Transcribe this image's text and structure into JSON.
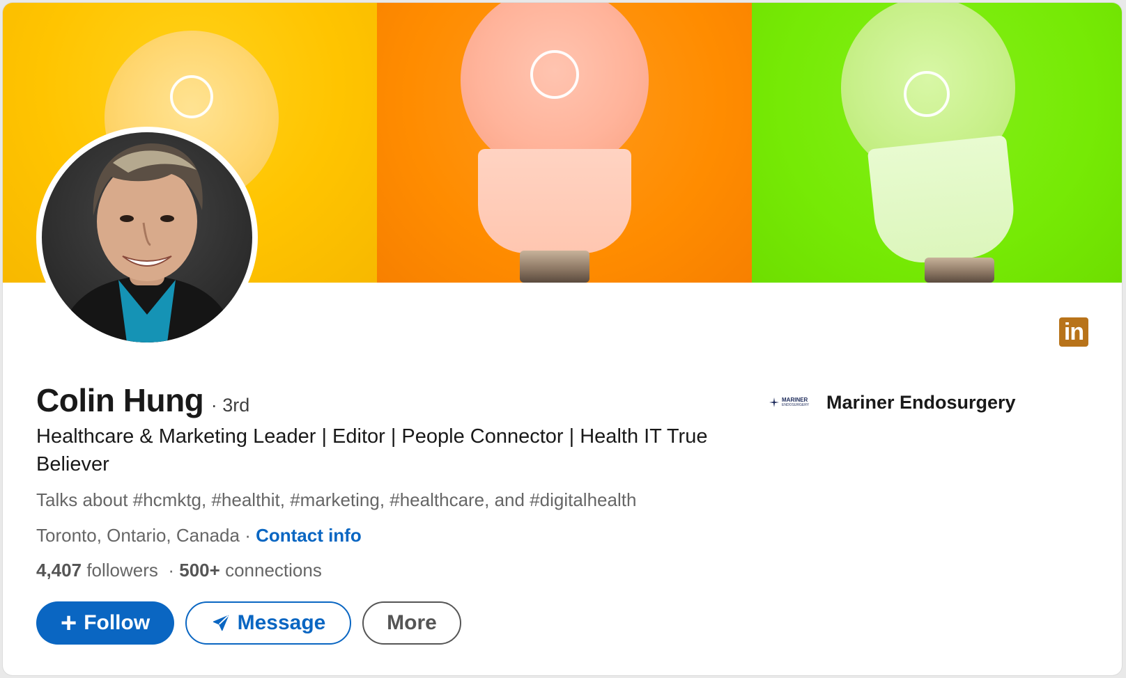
{
  "profile": {
    "name": "Colin Hung",
    "degree": "· 3rd",
    "headline": "Healthcare & Marketing Leader | Editor | People Connector | Health IT True Believer",
    "talks_about": "Talks about #hcmktg, #healthit, #marketing, #healthcare, and #digitalhealth",
    "location": "Toronto, Ontario, Canada",
    "location_separator": " · ",
    "contact_info": "Contact info",
    "followers_count": "4,407",
    "followers_label": "followers",
    "stats_separator": "·",
    "connections_count": "500+",
    "connections_label": "connections"
  },
  "company": {
    "name": "Mariner Endosurgery",
    "logo_text_line1": "MARINER",
    "logo_text_line2": "ENDOSURGERY"
  },
  "actions": {
    "follow_label": "Follow",
    "follow_icon": "plus-icon",
    "message_label": "Message",
    "message_icon": "send-icon",
    "more_label": "More"
  },
  "brand": {
    "logo_text": "in",
    "logo_color": "#b8731a"
  },
  "colors": {
    "accent": "#0a66c2",
    "banner_yellow": "#ffc400",
    "banner_orange": "#ff8c00",
    "banner_green": "#76ea05"
  }
}
